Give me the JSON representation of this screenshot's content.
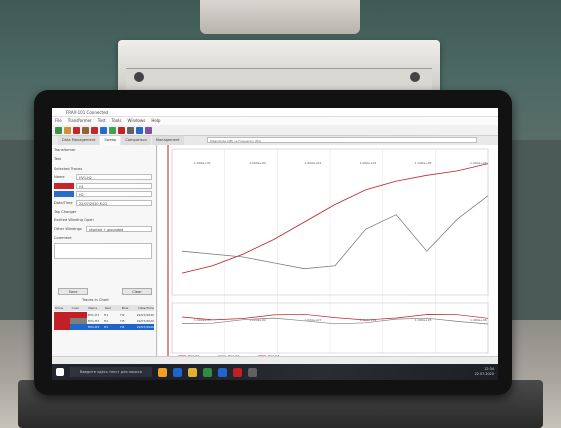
{
  "window": {
    "title": "FRAX-101 Connected"
  },
  "menu": [
    "File",
    "Transformer",
    "Test",
    "Tools",
    "Windows",
    "Help"
  ],
  "tabs": [
    "Data Management",
    "Sweep",
    "Comparison",
    "Management"
  ],
  "left_panel": {
    "transformer_label": "Transformer",
    "test_label": "Test",
    "selected_traces_label": "Selected Traces",
    "name_label": "Name",
    "name_value": "HV1-H2",
    "trace_a": "H1",
    "trace_b": "H2",
    "date_time_label": "Date/Time",
    "date_time_value": "22/07/2020 8:22",
    "tap_changer_label": "Tap Changer",
    "excitation_label": "Excited Winding Open",
    "other_windings_label": "Other Windings",
    "other_windings_value": "shorted + grounded",
    "comment_label": "Comment",
    "save_button": "Save",
    "clear_button": "Clear",
    "table": {
      "title": "Traces in Chart",
      "headers": [
        "Show",
        "Color",
        "Name",
        "Red",
        "Blue",
        "Date/Time"
      ],
      "rows": [
        [
          "",
          "",
          "HV1-H1",
          "H1",
          "H2",
          "22/07/2020"
        ],
        [
          "",
          "",
          "HV1-H2",
          "H1",
          "H3",
          "22/07/2020"
        ],
        [
          "",
          "",
          "HV1-H3",
          "H1",
          "H1",
          "22/07/2020"
        ]
      ]
    }
  },
  "chart_data": {
    "type": "line",
    "x_ticks_top": [
      "1.000e+01",
      "1.000e+02",
      "1.000e+03",
      "1.000e+04",
      "1.000e+05",
      "1.000e+06"
    ],
    "x_ticks_bottom": [
      "1.000e+01",
      "1.000e+02",
      "1.000e+03",
      "1.000e+04",
      "1.000e+05",
      "1.000e+06"
    ],
    "series": [
      {
        "color": "#c0181c",
        "values_top": [
          0.15,
          0.2,
          0.28,
          0.38,
          0.5,
          0.62,
          0.72,
          0.78,
          0.82,
          0.85,
          0.9
        ]
      },
      {
        "color": "#7a7a7a",
        "values_top": [
          0.3,
          0.28,
          0.26,
          0.22,
          0.18,
          0.2,
          0.45,
          0.55,
          0.3,
          0.52,
          0.68
        ]
      }
    ],
    "legend": [
      "HV1-H1",
      "HV1-H2",
      "HV1-H3"
    ]
  },
  "taskbar": {
    "search_placeholder": "Введите здесь текст для поиска",
    "clock_time": "12:34",
    "clock_date": "22.07.2020"
  },
  "status": "Magnitude (dB) vs Frequency (Hz)",
  "colors": {
    "trace_red": "#c0181c",
    "trace_gray": "#7a7a7a",
    "accent_blue": "#1a63c8"
  }
}
